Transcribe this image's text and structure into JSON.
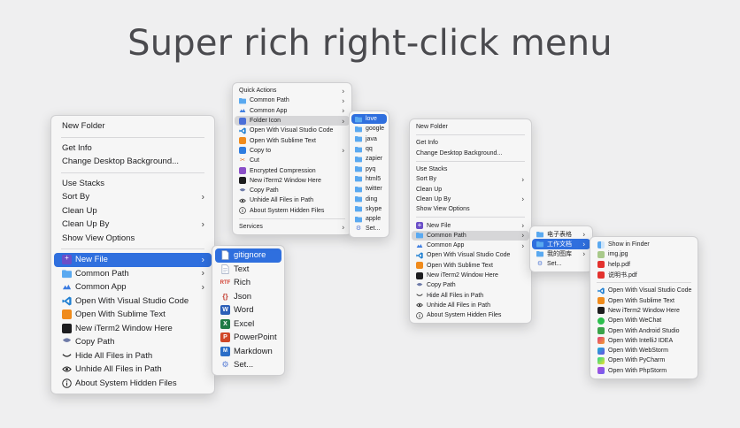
{
  "title": "Super rich right-click menu",
  "colors": {
    "selection": "#2f6fde",
    "folder": "#5aa9f0",
    "highlight": "#d6d6d8"
  },
  "menu_a": {
    "top_items": [
      "New Folder"
    ],
    "group2": [
      "Get Info",
      "Change Desktop Background..."
    ],
    "group3": [
      {
        "label": "Use Stacks",
        "arrow": false
      },
      {
        "label": "Sort By",
        "arrow": true
      },
      {
        "label": "Clean Up",
        "arrow": false
      },
      {
        "label": "Clean Up By",
        "arrow": true
      },
      {
        "label": "Show View Options",
        "arrow": false
      }
    ],
    "group4": [
      {
        "label": "New File",
        "icon": "new-file-icon",
        "arrow": true,
        "state": "sel"
      },
      {
        "label": "Common Path",
        "icon": "folder-icon",
        "arrow": true
      },
      {
        "label": "Common App",
        "icon": "app-icon",
        "arrow": true
      },
      {
        "label": "Open With Visual Studio Code",
        "icon": "vscode-icon"
      },
      {
        "label": "Open With Sublime Text",
        "icon": "sublime-icon"
      },
      {
        "label": "New iTerm2 Window Here",
        "icon": "iterm-icon"
      },
      {
        "label": "Copy Path",
        "icon": "copy-path-icon"
      },
      {
        "label": "Hide All Files in Path",
        "icon": "eye-closed-icon"
      },
      {
        "label": "Unhide All Files in Path",
        "icon": "eye-icon"
      },
      {
        "label": "About System Hidden Files",
        "icon": "info-icon"
      }
    ]
  },
  "submenu_new_file": [
    {
      "label": "gitignore",
      "icon": "doc-icon",
      "state": "sel"
    },
    {
      "label": "Text",
      "icon": "text-doc-icon"
    },
    {
      "label": "Rich",
      "icon": "rtf-icon"
    },
    {
      "label": "Json",
      "icon": "json-icon"
    },
    {
      "label": "Word",
      "icon": "word-icon"
    },
    {
      "label": "Excel",
      "icon": "excel-icon"
    },
    {
      "label": "PowerPoint",
      "icon": "powerpoint-icon"
    },
    {
      "label": "Markdown",
      "icon": "markdown-icon"
    },
    {
      "label": "Set...",
      "icon": "gear-icon"
    }
  ],
  "menu_b": {
    "items": [
      {
        "label": "Quick Actions",
        "arrow": true
      },
      {
        "label": "Common Path",
        "icon": "folder-icon",
        "arrow": true
      },
      {
        "label": "Common App",
        "icon": "app-icon",
        "arrow": true
      },
      {
        "label": "Folder Icon",
        "icon": "folder-icon-icon",
        "arrow": true,
        "state": "hl"
      },
      {
        "label": "Open With Visual Studio Code",
        "icon": "vscode-icon"
      },
      {
        "label": "Open With Sublime Text",
        "icon": "sublime-icon"
      },
      {
        "label": "Copy to",
        "icon": "copy-icon",
        "arrow": true
      },
      {
        "label": "Cut",
        "icon": "scissors-icon"
      },
      {
        "label": "Encrypted Compression",
        "icon": "archive-icon"
      },
      {
        "label": "New iTerm2 Window Here",
        "icon": "iterm-icon"
      },
      {
        "label": "Copy Path",
        "icon": "copy-path-icon"
      },
      {
        "label": "Unhide All Files in Path",
        "icon": "eye-icon"
      },
      {
        "label": "About System Hidden Files",
        "icon": "info-icon"
      }
    ],
    "services": "Services"
  },
  "submenu_folder_icon": [
    {
      "label": "love",
      "icon": "folder-icon",
      "state": "sel"
    },
    {
      "label": "google",
      "icon": "folder-icon"
    },
    {
      "label": "java",
      "icon": "folder-icon"
    },
    {
      "label": "qq",
      "icon": "folder-icon"
    },
    {
      "label": "zapier",
      "icon": "folder-icon"
    },
    {
      "label": "pyq",
      "icon": "folder-icon"
    },
    {
      "label": "html5",
      "icon": "folder-icon"
    },
    {
      "label": "twitter",
      "icon": "folder-icon"
    },
    {
      "label": "ding",
      "icon": "folder-icon"
    },
    {
      "label": "skype",
      "icon": "folder-icon"
    },
    {
      "label": "apple",
      "icon": "folder-icon"
    },
    {
      "label": "Set...",
      "icon": "gear-icon"
    }
  ],
  "menu_c": {
    "top_items": [
      "New Folder"
    ],
    "group2": [
      "Get Info",
      "Change Desktop Background..."
    ],
    "group3": [
      {
        "label": "Use Stacks",
        "arrow": false
      },
      {
        "label": "Sort By",
        "arrow": true
      },
      {
        "label": "Clean Up",
        "arrow": false
      },
      {
        "label": "Clean Up By",
        "arrow": true
      },
      {
        "label": "Show View Options",
        "arrow": false
      }
    ],
    "group4": [
      {
        "label": "New File",
        "icon": "new-file-icon",
        "arrow": true
      },
      {
        "label": "Common Path",
        "icon": "folder-icon",
        "arrow": true,
        "state": "hl"
      },
      {
        "label": "Common App",
        "icon": "app-icon",
        "arrow": true
      },
      {
        "label": "Open With Visual Studio Code",
        "icon": "vscode-icon"
      },
      {
        "label": "Open With Sublime Text",
        "icon": "sublime-icon"
      },
      {
        "label": "New iTerm2 Window Here",
        "icon": "iterm-icon"
      },
      {
        "label": "Copy Path",
        "icon": "copy-path-icon"
      },
      {
        "label": "Hide All Files in Path",
        "icon": "eye-closed-icon"
      },
      {
        "label": "Unhide All Files in Path",
        "icon": "eye-icon"
      },
      {
        "label": "About System Hidden Files",
        "icon": "info-icon"
      }
    ]
  },
  "submenu_common_path": [
    {
      "label": "电子表格",
      "icon": "folder-icon",
      "arrow": true
    },
    {
      "label": "工作文档",
      "icon": "folder-icon",
      "arrow": true,
      "state": "sel"
    },
    {
      "label": "我的图库",
      "icon": "folder-icon",
      "arrow": true
    },
    {
      "label": "Set...",
      "icon": "gear-icon"
    }
  ],
  "submenu_work_docs": {
    "group1": [
      {
        "label": "Show in Finder",
        "icon": "finder-icon"
      },
      {
        "label": "img.jpg",
        "icon": "image-icon"
      },
      {
        "label": "help.pdf",
        "icon": "pdf-icon"
      },
      {
        "label": "说明书.pdf",
        "icon": "pdf-icon"
      }
    ],
    "group2": [
      {
        "label": "Open With Visual Studio Code",
        "icon": "vscode-icon"
      },
      {
        "label": "Open With Sublime Text",
        "icon": "sublime-icon"
      },
      {
        "label": "New iTerm2 Window Here",
        "icon": "iterm-icon"
      },
      {
        "label": "Open With WeChat",
        "icon": "wechat-icon"
      },
      {
        "label": "Open With Android Studio",
        "icon": "android-studio-icon"
      },
      {
        "label": "Open With IntelliJ IDEA",
        "icon": "intellij-icon"
      },
      {
        "label": "Open With WebStorm",
        "icon": "webstorm-icon"
      },
      {
        "label": "Open With PyCharm",
        "icon": "pycharm-icon"
      },
      {
        "label": "Open With PhpStorm",
        "icon": "phpstorm-icon"
      }
    ]
  }
}
